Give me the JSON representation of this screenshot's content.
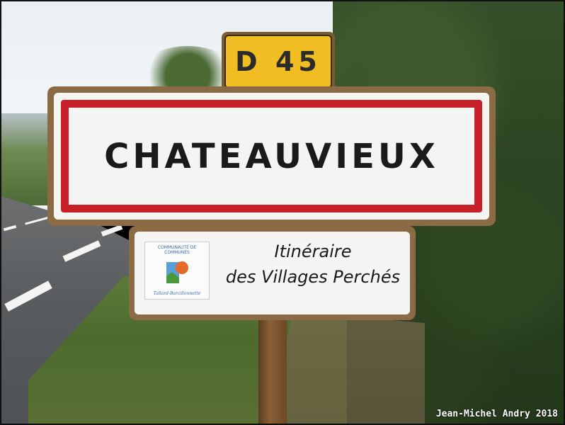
{
  "route_plate": {
    "label": "D 45"
  },
  "town_sign": {
    "name": "CHATEAUVIEUX"
  },
  "info_sign": {
    "logo_header": "COMMUNAUTÉ DE COMMUNES",
    "logo_signature": "Tallard-Barcillonnette",
    "line1": "Itinéraire",
    "line2": "des Villages Perchés"
  },
  "credit": "Jean-Michel Andry 2018",
  "colors": {
    "sign_red": "#c8202b",
    "route_yellow": "#f0bd22",
    "sign_frame": "#8b6b45"
  }
}
